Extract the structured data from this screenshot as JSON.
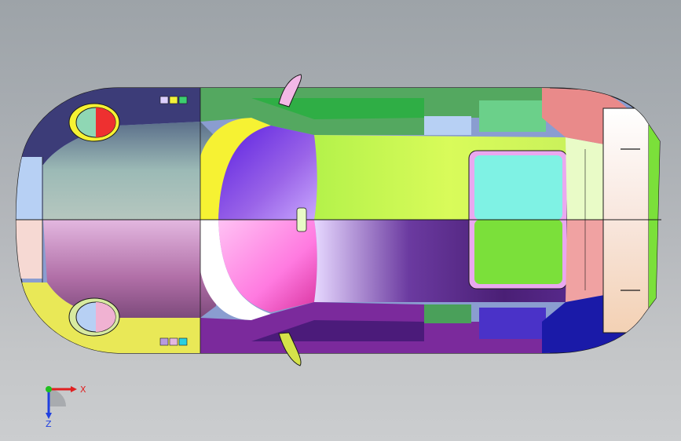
{
  "viewport": {
    "background_top": "#9da3a8",
    "background_bottom": "#cbcdcf"
  },
  "model": {
    "outline_color": "#1a1a1a",
    "colors": {
      "dark_navy": "#3c3c78",
      "teal_gray": "#8fb0ae",
      "mauve": "#b07aa8",
      "purple_blue": "#6b2fd8",
      "pink_magenta": "#ff84e8",
      "lime": "#c6f53a",
      "deep_purple": "#4a1f75",
      "cyan": "#7ff2e4",
      "green": "#7be03a",
      "yellow": "#f4f23a",
      "salmon": "#e89a9a",
      "light_blue": "#b7d0f4",
      "pale_pink": "#f6d9d3",
      "red": "#ee3030",
      "navy": "#1a1aa8"
    }
  },
  "triad": {
    "x_label": "X",
    "z_label": "Z",
    "x_color": "#e02020",
    "y_color": "#20c020",
    "z_color": "#2040e0"
  }
}
